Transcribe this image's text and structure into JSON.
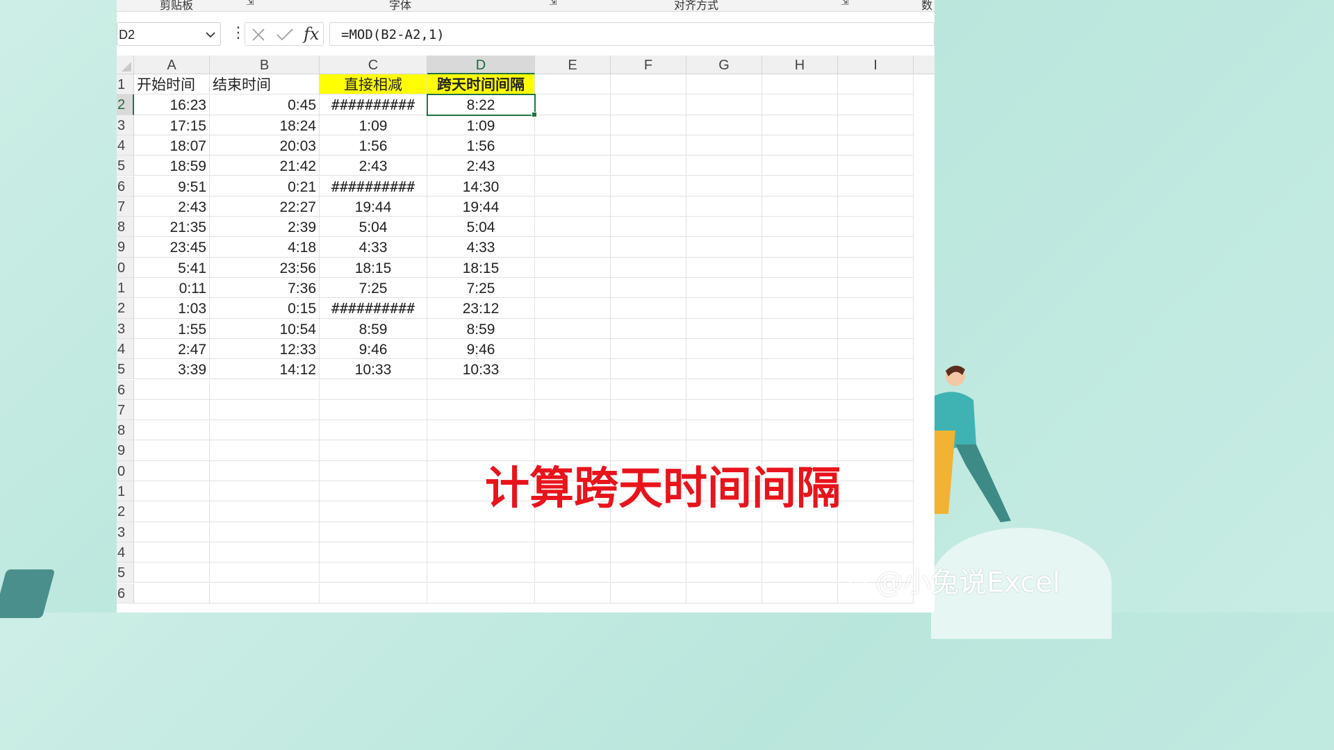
{
  "ribbon": {
    "groups": [
      "剪贴板",
      "字体",
      "对齐方式",
      "数"
    ]
  },
  "formula_bar": {
    "name_box": "D2",
    "formula": "=MOD(B2-A2,1)"
  },
  "columns": [
    "A",
    "B",
    "C",
    "D",
    "E",
    "F",
    "G",
    "H",
    "I"
  ],
  "row_labels": [
    "1",
    "2",
    "3",
    "4",
    "5",
    "6",
    "7",
    "8",
    "9",
    "0",
    "1",
    "2",
    "3",
    "4",
    "5",
    "6",
    "7",
    "8",
    "9",
    "0",
    "1",
    "2",
    "3",
    "4",
    "5",
    "6"
  ],
  "headers": {
    "a": "开始时间",
    "b": "结束时间",
    "c": "直接相减",
    "d": "跨天时间间隔"
  },
  "rows": [
    {
      "a": "16:23",
      "b": "0:45",
      "c": "##########",
      "d": "8:22"
    },
    {
      "a": "17:15",
      "b": "18:24",
      "c": "1:09",
      "d": "1:09"
    },
    {
      "a": "18:07",
      "b": "20:03",
      "c": "1:56",
      "d": "1:56"
    },
    {
      "a": "18:59",
      "b": "21:42",
      "c": "2:43",
      "d": "2:43"
    },
    {
      "a": "9:51",
      "b": "0:21",
      "c": "##########",
      "d": "14:30"
    },
    {
      "a": "2:43",
      "b": "22:27",
      "c": "19:44",
      "d": "19:44"
    },
    {
      "a": "21:35",
      "b": "2:39",
      "c": "5:04",
      "d": "5:04"
    },
    {
      "a": "23:45",
      "b": "4:18",
      "c": "4:33",
      "d": "4:33"
    },
    {
      "a": "5:41",
      "b": "23:56",
      "c": "18:15",
      "d": "18:15"
    },
    {
      "a": "0:11",
      "b": "7:36",
      "c": "7:25",
      "d": "7:25"
    },
    {
      "a": "1:03",
      "b": "0:15",
      "c": "##########",
      "d": "23:12"
    },
    {
      "a": "1:55",
      "b": "10:54",
      "c": "8:59",
      "d": "8:59"
    },
    {
      "a": "2:47",
      "b": "12:33",
      "c": "9:46",
      "d": "9:46"
    },
    {
      "a": "3:39",
      "b": "14:12",
      "c": "10:33",
      "d": "10:33"
    }
  ],
  "overlay_title": "计算跨天时间间隔",
  "watermark": "@小兔说Excel",
  "colors": {
    "header_fill": "#ffff00",
    "selection": "#217346",
    "overlay_text": "#e8141c"
  }
}
